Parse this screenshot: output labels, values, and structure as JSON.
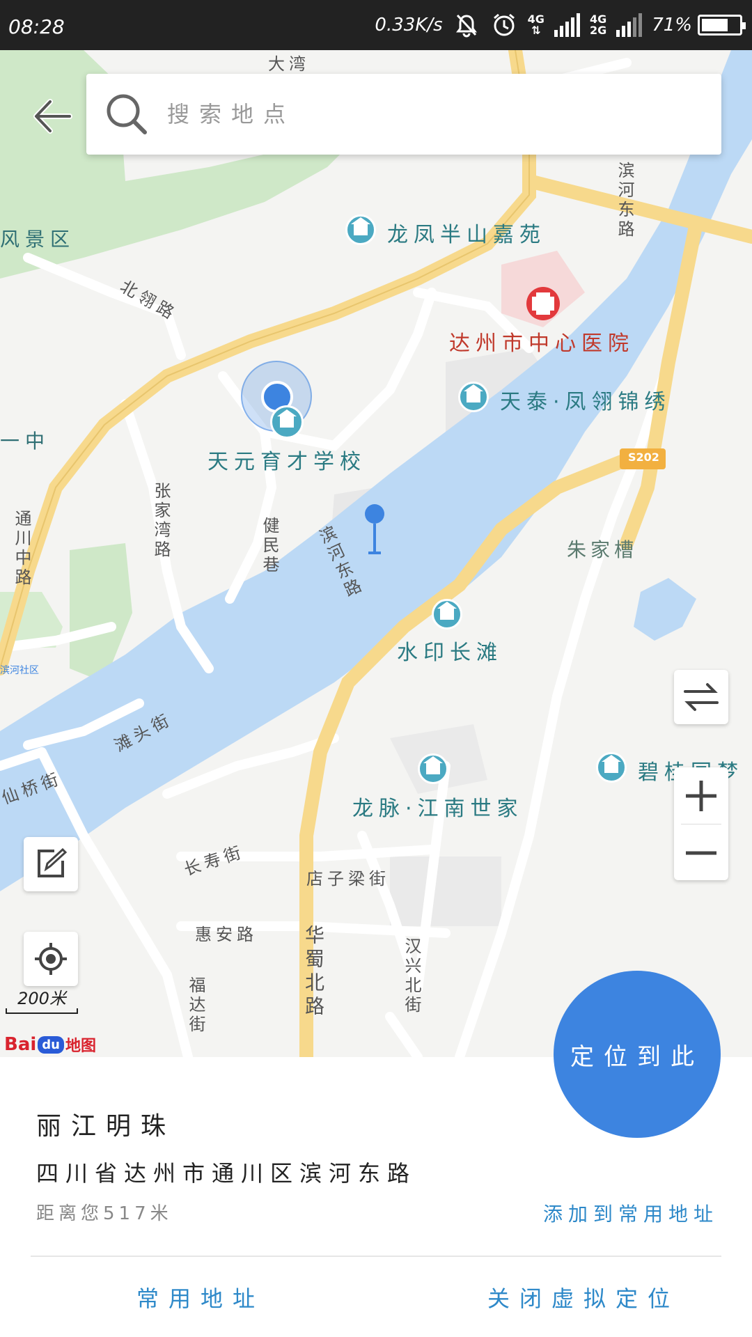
{
  "status_bar": {
    "time": "08:28",
    "net_speed": "0.33K/s",
    "network_1": "4G",
    "network_2_top": "4G",
    "network_2_bottom": "2G",
    "battery": "71%",
    "battery_level": 0.71,
    "icons": [
      "bell-off-icon",
      "alarm-icon",
      "signal-icon",
      "battery-icon"
    ]
  },
  "search": {
    "placeholder": "搜索地点"
  },
  "map": {
    "labels": {
      "dawan": "大湾",
      "scenic": "风景区",
      "longfeng": "龙凤半山嘉苑",
      "binhe_east_road_top": "滨河东路",
      "hospital": "达州市中心医院",
      "beiling_road": "北翎路",
      "tiantai": "天泰·凤翎锦绣",
      "school": "天元育才学校",
      "yizhong": "一中",
      "zhangjiawan_road": "张家湾路",
      "jianmin_lane": "健民巷",
      "binhe_east_road": "滨河东路",
      "zhujiacao": "朱家槽",
      "tongchuan_road": "通川中路",
      "shuiyin": "水印长滩",
      "community": "滨河社区",
      "tantou_street": "滩头街",
      "bilin": "碧桂园梦",
      "longmai": "龙脉·江南世家",
      "xianqiao_street": "仙桥街",
      "changshou_street": "长寿街",
      "dianziliang_street": "店子梁街",
      "huian_road": "惠安路",
      "huashu_road": "华蜀北路",
      "hanxing_street": "汉兴北街",
      "fuda_street": "福达街",
      "shield": "S202"
    },
    "scale_label": "200米",
    "brand_bai": "Bai",
    "brand_du": "du",
    "brand_map": "地图"
  },
  "fab": {
    "locate_here": "定位到此"
  },
  "place": {
    "name": "丽江明珠",
    "address": "四川省达州市通川区滨河东路",
    "distance": "距离您517米",
    "add_common": "添加到常用地址"
  },
  "bottom": {
    "common_address": "常用地址",
    "close_virtual": "关闭虚拟定位"
  },
  "colors": {
    "accent": "#3d84e0",
    "link": "#2e89c9",
    "river": "#bcd9f5",
    "major_road": "#f7d98c",
    "green": "#cfe8c8",
    "hospital_red": "#e2393c",
    "poi": "#4ba9c2"
  }
}
